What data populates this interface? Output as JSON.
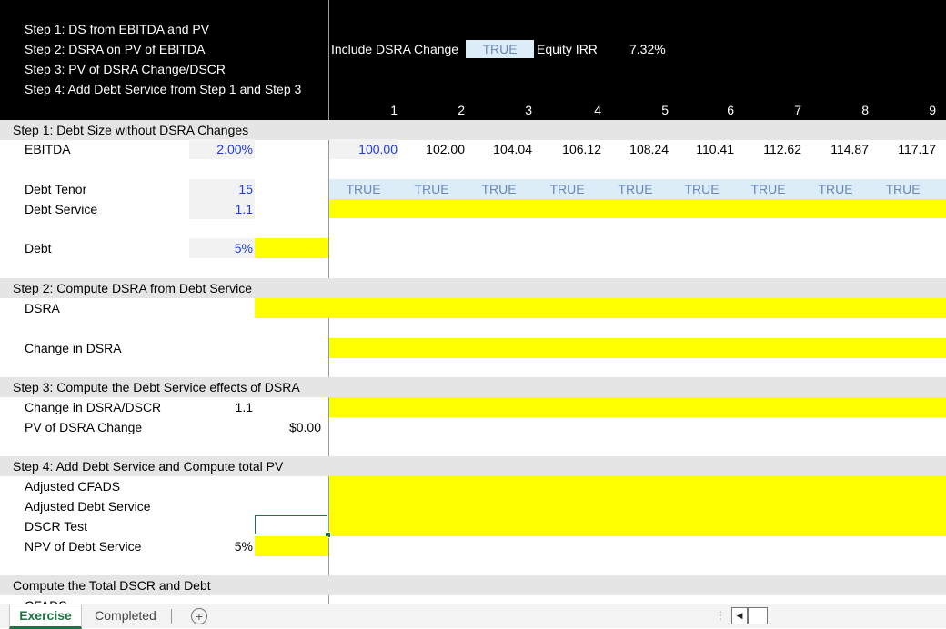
{
  "header": {
    "steps": [
      "Step 1: DS from EBITDA and PV",
      "Step 2: DSRA on PV of EBITDA",
      "Step 3: PV of DSRA Change/DSCR",
      "Step 4: Add Debt Service from Step 1 and Step 3"
    ],
    "include_dsra_label": "Include DSRA Change",
    "include_dsra_value": "TRUE",
    "equity_irr_label": "Equity IRR",
    "equity_irr_value": "7.32%",
    "periods": [
      "1",
      "2",
      "3",
      "4",
      "5",
      "6",
      "7",
      "8",
      "9"
    ]
  },
  "step1": {
    "title": "Step 1: Debt Size without DSRA Changes",
    "ebitda_label": "EBITDA",
    "ebitda_growth": "2.00%",
    "ebitda_values": [
      "100.00",
      "102.00",
      "104.04",
      "106.12",
      "108.24",
      "110.41",
      "112.62",
      "114.87",
      "117.17"
    ],
    "tenor_label": "Debt Tenor",
    "tenor_value": "15",
    "tenor_flags": [
      "TRUE",
      "TRUE",
      "TRUE",
      "TRUE",
      "TRUE",
      "TRUE",
      "TRUE",
      "TRUE",
      "TRUE"
    ],
    "debt_service_label": "Debt Service",
    "debt_service_value": "1.1",
    "debt_label": "Debt",
    "debt_rate": "5%"
  },
  "step2": {
    "title": "Step 2: Compute DSRA from Debt Service",
    "dsra_label": "DSRA",
    "change_label": "Change in DSRA"
  },
  "step3": {
    "title": "Step 3: Compute the Debt Service effects of DSRA",
    "change_dscr_label": "Change in DSRA/DSCR",
    "change_dscr_value": "1.1",
    "pv_label": "PV of DSRA Change",
    "pv_value": "$0.00"
  },
  "step4": {
    "title": "Step 4: Add Debt Service and Compute total PV",
    "adj_cfads_label": "Adjusted CFADS",
    "adj_ds_label": "Adjusted Debt Service",
    "dscr_test_label": "DSCR Test",
    "npv_label": "NPV of Debt Service",
    "npv_rate": "5%"
  },
  "total": {
    "title": "Compute the Total DSCR and Debt",
    "cut_label": "CFADS"
  },
  "tabs": {
    "active": "Exercise",
    "inactive": "Completed",
    "add": "+"
  },
  "colors": {
    "header_bg": "#000000",
    "section_gray": "#e5e5e5",
    "highlight_yellow": "#ffff00",
    "input_blue_bg": "#dcedf8",
    "input_text_blue": "#1f3dd6",
    "active_tab_green": "#217346"
  }
}
